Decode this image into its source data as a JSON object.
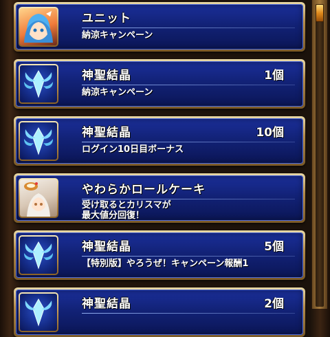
{
  "rewards": [
    {
      "icon": "character-portrait-icon",
      "title": "ユニット",
      "quantity": "",
      "description": "納涼キャンペーン"
    },
    {
      "icon": "divine-crystal-icon",
      "title": "神聖結晶",
      "quantity": "1個",
      "description": "納涼キャンペーン"
    },
    {
      "icon": "divine-crystal-icon",
      "title": "神聖結晶",
      "quantity": "10個",
      "description": "ログイン10日目ボーナス"
    },
    {
      "icon": "roll-cake-icon",
      "title": "やわらかロールケーキ",
      "quantity": "",
      "description": "受け取るとカリスマが\n最大値分回復！"
    },
    {
      "icon": "divine-crystal-icon",
      "title": "神聖結晶",
      "quantity": "5個",
      "description": "【特別版】やろうぜ！キャンペーン報酬1"
    },
    {
      "icon": "divine-crystal-icon",
      "title": "神聖結晶",
      "quantity": "2個",
      "description": ""
    }
  ],
  "colors": {
    "card_blue": "#1b2f9a",
    "frame_gold": "#c79a4f",
    "scroll_thumb": "#e08a1c"
  }
}
